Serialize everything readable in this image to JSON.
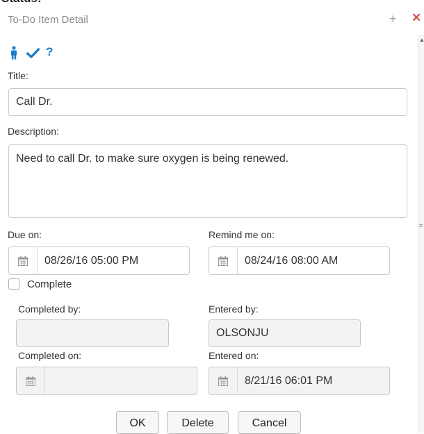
{
  "background_text": "Status:",
  "dialog": {
    "title": "To-Do Item Detail",
    "plus_glyph": "+",
    "close_glyph": "✕",
    "accent_color": "#1f7cc4",
    "close_color": "#d9534f"
  },
  "toolbar": {
    "icons": [
      "person-icon",
      "check-icon",
      "help-icon"
    ],
    "help_glyph": "?"
  },
  "form": {
    "title_label": "Title:",
    "title_value": "Call Dr.",
    "description_label": "Description:",
    "description_value": "Need to call Dr. to make sure oxygen is being renewed.",
    "due_label": "Due on:",
    "due_value": "08/26/16 05:00 PM",
    "remind_label": "Remind me on:",
    "remind_value": "08/24/16 08:00 AM",
    "complete_label": "Complete",
    "complete_checked": false,
    "completed_by_label": "Completed by:",
    "completed_by_value": "",
    "entered_by_label": "Entered by:",
    "entered_by_value": "OLSONJU",
    "completed_on_label": "Completed on:",
    "completed_on_value": "",
    "entered_on_label": "Entered on:",
    "entered_on_value": "8/21/16 06:01 PM"
  },
  "buttons": {
    "ok": "OK",
    "delete": "Delete",
    "cancel": "Cancel"
  }
}
